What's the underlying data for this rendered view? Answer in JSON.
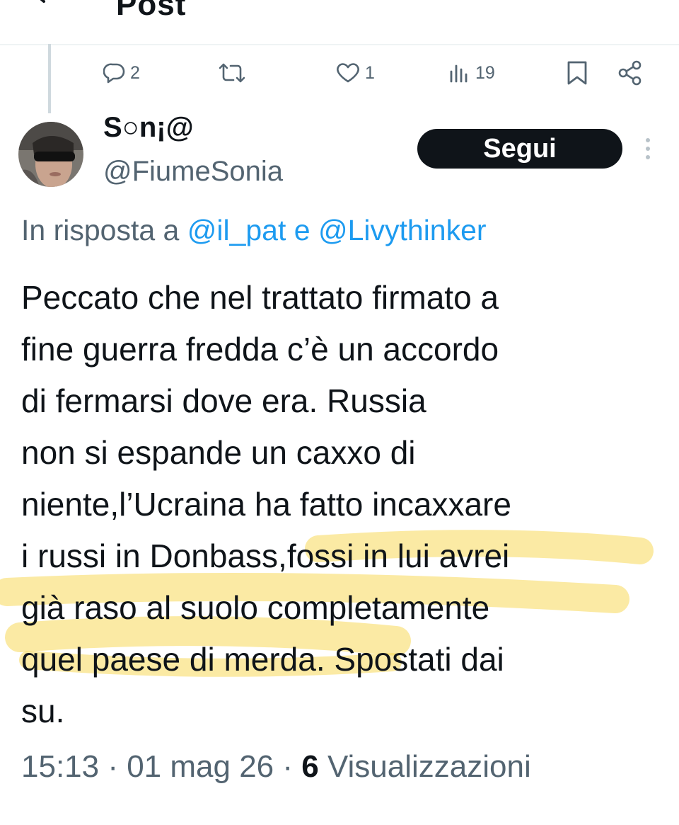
{
  "header": {
    "title": "Post",
    "back_icon": "arrow-left-icon"
  },
  "actions": {
    "reply_count": "2",
    "retweet_count": "",
    "like_count": "1",
    "views_count": "19",
    "icons": [
      "reply-icon",
      "retweet-icon",
      "heart-icon",
      "analytics-icon",
      "bookmark-icon",
      "share-icon"
    ]
  },
  "author": {
    "display_name": "S○n¡@",
    "handle": "@FiumeSonia",
    "follow_label": "Segui"
  },
  "reply_to": {
    "prefix": "In risposta a ",
    "user1": "@il_pat",
    "joiner": " e ",
    "user2": "@Livythinker"
  },
  "tweet": {
    "lines": [
      "Peccato che nel trattato firmato a",
      "fine guerra fredda c’è un accordo",
      "di fermarsi dove era. Russia",
      "non si espande un caxxo di",
      "niente,l’Ucraina ha fatto incaxxare",
      "i russi in Donbass,fossi in lui avrei",
      "già raso al suolo completamente",
      "quel paese di merda. Spostati dai",
      "su."
    ]
  },
  "meta": {
    "timestamp": "15:13 · 01 mag 26 · ",
    "views_count": "6",
    "views_label": " Visualizzazioni"
  },
  "colors": {
    "text_primary": "#0f1419",
    "text_secondary": "#536471",
    "link": "#1d9bf0",
    "highlight": "#f7d85a"
  }
}
